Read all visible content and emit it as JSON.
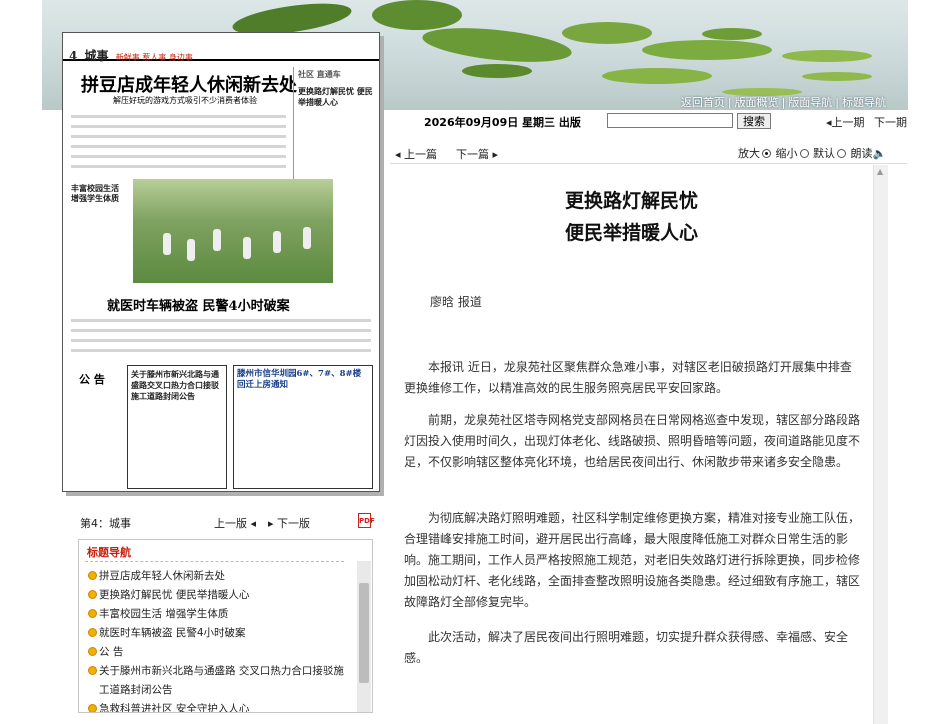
{
  "banner": {
    "links": [
      "返回首页",
      "版面概览",
      "版面导航",
      "标题导航"
    ]
  },
  "paper": {
    "page_no": "4",
    "section": "城事",
    "slogan": "新鲜事 惹人事 身边事",
    "headline_main": "拼豆店成年轻人休闲新去处",
    "subhead_main": "解压好玩的游戏方式吸引不少消费者体验",
    "headline_side1": "更换路灯解民忧 便民举措暖人心",
    "headline_photo": "丰富校园生活 增强学生体质",
    "headline_car": "就医时车辆被盗 民警4小时破案",
    "notice_label": "公 告",
    "notice_box_title": "关于滕州市新兴北路与通盛路交叉口热力合口接驳施工道路封闭公告",
    "notice_box2_title": "滕州市信华圳园6#、7#、8#楼回迁上房通知",
    "side_column_label": "社区 直通车"
  },
  "header": {
    "date": "2026年09月09日 星期三 出版",
    "search_placeholder": "",
    "search_button": "搜索",
    "prev_period": "上一期",
    "next_period": "下一期"
  },
  "toolbar": {
    "prev_article": "上一篇",
    "next_article": "下一篇",
    "zoom_in": "放大",
    "zoom_out": "缩小",
    "default": "默认",
    "read_aloud": "朗读"
  },
  "article": {
    "title_line1": "更换路灯解民忧",
    "title_line2": "便民举措暖人心",
    "author": "廖晗 报道",
    "paragraphs": [
      "本报讯 近日，龙泉苑社区聚焦群众急难小事，对辖区老旧破损路灯开展集中排查更换维修工作，以精准高效的民生服务照亮居民平安回家路。",
      "前期，龙泉苑社区塔寺网格党支部网格员在日常网格巡查中发现，辖区部分路段路灯因投入使用时间久，出现灯体老化、线路破损、照明昏暗等问题，夜间道路能见度不足，不仅影响辖区整体亮化环境，也给居民夜间出行、休闲散步带来诸多安全隐患。",
      "为彻底解决路灯照明难题，社区科学制定维修更换方案，精准对接专业施工队伍，合理错峰安排施工时间，避开居民出行高峰，最大限度降低施工对群众日常生活的影响。施工期间，工作人员严格按照施工规范，对老旧失效路灯进行拆除更换，同步检修加固松动灯杆、老化线路，全面排查整改照明设施各类隐患。经过细致有序施工，辖区故障路灯全部修复完毕。",
      "此次活动，解决了居民夜间出行照明难题，切实提升群众获得感、幸福感、安全感。"
    ]
  },
  "left_nav": {
    "page_label": "第4：城事",
    "prev_page": "上一版",
    "next_page": "下一版",
    "pdf_label": "PDF"
  },
  "title_nav": {
    "heading": "标题导航",
    "items": [
      "拼豆店成年轻人休闲新去处",
      "更换路灯解民忧 便民举措暖人心",
      "丰富校园生活 增强学生体质",
      "就医时车辆被盗 民警4小时破案",
      "公 告",
      "关于滕州市新兴北路与通盛路 交叉口热力合口接驳施工道路封闭公告",
      "急救科普进社区 安全守护入人心"
    ]
  },
  "colors": {
    "accent_red": "#c8200e",
    "bullet_orange": "#f0b000"
  }
}
